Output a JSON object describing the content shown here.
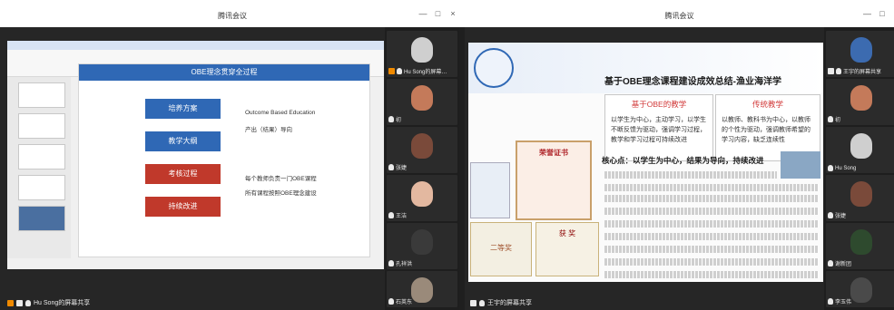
{
  "left_window": {
    "title": "腾讯会议",
    "controls": [
      "—",
      "□",
      "×"
    ],
    "ppt_slide": {
      "title": "OBE理念贯穿全过程",
      "steps": [
        {
          "label": "培养方案",
          "color": "#2f68b5"
        },
        {
          "label": "教学大纲",
          "color": "#2f68b5"
        },
        {
          "label": "考核过程",
          "color": "#c0392b"
        },
        {
          "label": "持续改进",
          "color": "#c0392b"
        }
      ],
      "notes": [
        "Outcome Based Education",
        "产出（结果）导向",
        "每个教师负责一门OBE课程",
        "所有课程按照OBE理念建设"
      ]
    },
    "participants": [
      {
        "name": "Hu Song的屏幕…",
        "face": "#cfcfcf"
      },
      {
        "name": "初",
        "face": "#c47a5a"
      },
      {
        "name": "张婕",
        "face": "#7a4a3a"
      },
      {
        "name": "王洁",
        "face": "#e3b8a0"
      },
      {
        "name": "孔祥洪",
        "face": "#3a3a3a"
      },
      {
        "name": "石英东",
        "face": "#9a8a7a"
      }
    ],
    "bottom_share": "Hu Song的屏幕共享"
  },
  "right_window": {
    "title": "腾讯会议",
    "controls": [
      "—",
      "□"
    ],
    "slide": {
      "title": "基于OBE理念课程建设成效总结-渔业海洋学",
      "box_left_heading": "基于OBE的教学",
      "box_left_text": "以学生为中心，主动学习，以学生不断反馈为驱动，强调学习过程，教学和学习过程可持续改进",
      "box_right_heading": "传统教学",
      "box_right_text": "以教师、教科书为中心，以教师的个性为驱动，强调教师希望的学习内容，缺乏连续性",
      "core": "核心点：以学生为中心，结果为导向，持续改进",
      "certificate_title": "荣誉证书",
      "award_left": "二等奖",
      "award_right": "获 奖"
    },
    "participants": [
      {
        "name": "王宇的屏幕共享",
        "face": "#3c6bb0"
      },
      {
        "name": "初",
        "face": "#c47a5a"
      },
      {
        "name": "Hu Song",
        "face": "#cfcfcf"
      },
      {
        "name": "张婕",
        "face": "#7a4a3a"
      },
      {
        "name": "谢新团",
        "face": "#2e4a2e"
      },
      {
        "name": "李玉伟",
        "face": "#4a4a4a"
      }
    ],
    "bottom_share": "王宇的屏幕共享"
  }
}
